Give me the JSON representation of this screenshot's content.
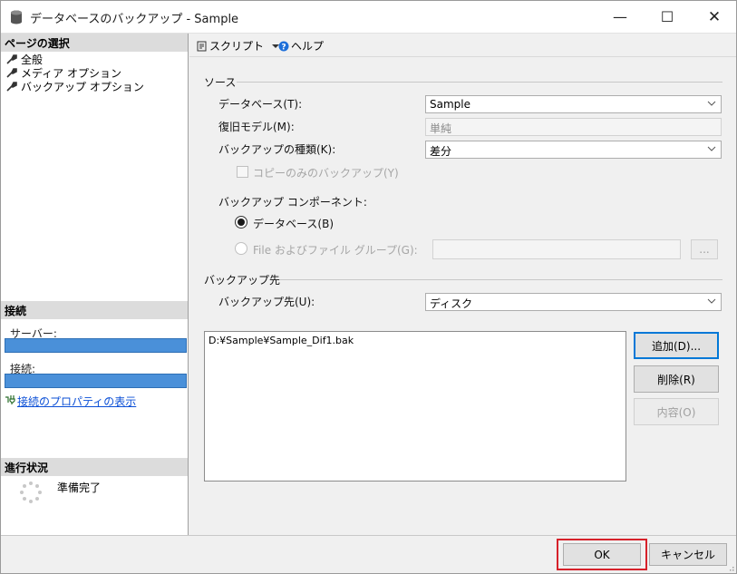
{
  "window": {
    "title": "データベースのバックアップ - Sample",
    "minimize": "—",
    "maximize": "☐",
    "close": "✕"
  },
  "left_panel": {
    "page_select_header": "ページの選択",
    "pages": [
      {
        "label": "全般"
      },
      {
        "label": "メディア オプション"
      },
      {
        "label": "バックアップ オプション"
      }
    ],
    "connection_header": "接続",
    "server_label": "サーバー:",
    "connection_label": "接続:",
    "view_properties_link": "接続のプロパティの表示",
    "progress_header": "進行状況",
    "progress_status": "準備完了"
  },
  "toolbar": {
    "script_label": "スクリプト",
    "help_label": "ヘルプ"
  },
  "source": {
    "group_label": "ソース",
    "database_label": "データベース(T):",
    "database_value": "Sample",
    "recovery_model_label": "復旧モデル(M):",
    "recovery_model_value": "単純",
    "backup_type_label": "バックアップの種類(K):",
    "backup_type_value": "差分",
    "copy_only_label": "コピーのみのバックアップ(Y)",
    "component_label": "バックアップ コンポーネント:",
    "component_database": "データベース(B)",
    "component_files": "File およびファイル グループ(G):",
    "browse_label": "..."
  },
  "destination": {
    "group_label": "バックアップ先",
    "backup_to_label": "バックアップ先(U):",
    "backup_to_value": "ディスク",
    "files": [
      "D:¥Sample¥Sample_Dif1.bak"
    ],
    "add_button": "追加(D)...",
    "remove_button": "削除(R)",
    "contents_button": "内容(O)"
  },
  "footer": {
    "ok_button": "OK",
    "cancel_button": "キャンセル"
  },
  "colors": {
    "highlight": "#d6212a",
    "link": "#0b4fd6",
    "connection_bar": "#4a90d9",
    "focus_border": "#0078d7"
  }
}
